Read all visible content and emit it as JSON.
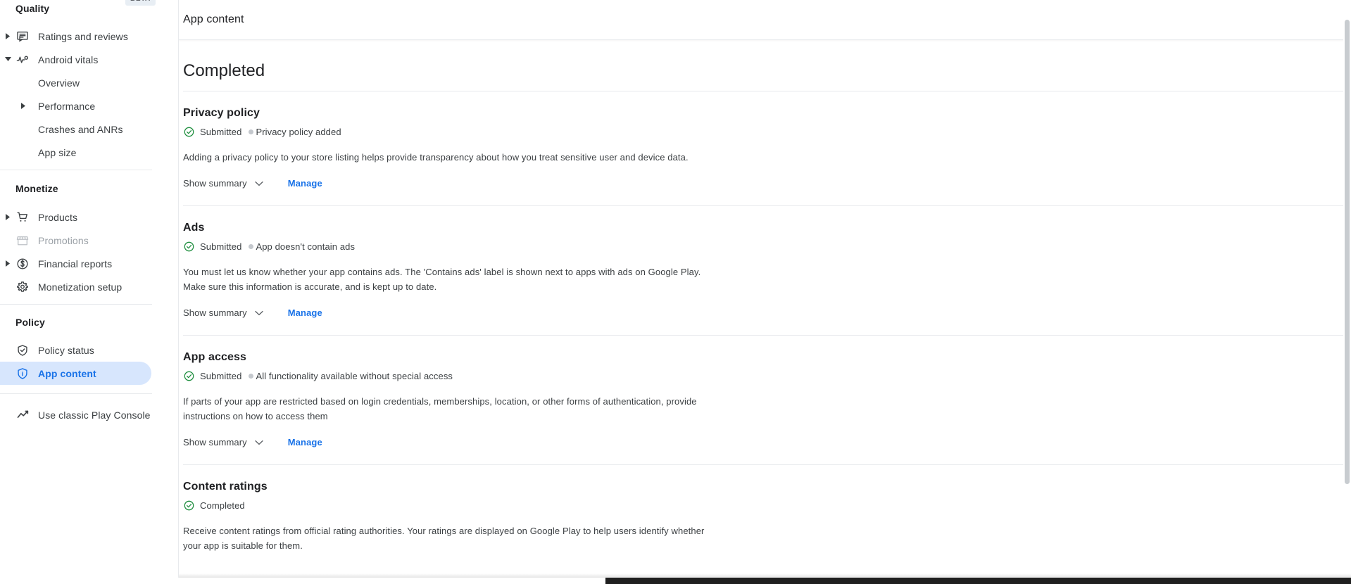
{
  "sidebar": {
    "beta_badge": "BETA",
    "groups": [
      {
        "label": "Quality",
        "items": [
          {
            "label": "Ratings and reviews",
            "icon": "reviews-icon",
            "caret": "collapsed",
            "level": 0
          },
          {
            "label": "Android vitals",
            "icon": "vitals-icon",
            "caret": "expanded",
            "level": 0
          },
          {
            "label": "Overview",
            "icon": "",
            "caret": "none",
            "level": 1
          },
          {
            "label": "Performance",
            "icon": "",
            "caret": "collapsed",
            "level": 1
          },
          {
            "label": "Crashes and ANRs",
            "icon": "",
            "caret": "none",
            "level": 1
          },
          {
            "label": "App size",
            "icon": "",
            "caret": "none",
            "level": 1
          }
        ]
      },
      {
        "label": "Monetize",
        "items": [
          {
            "label": "Products",
            "icon": "cart-icon",
            "caret": "collapsed",
            "level": 0
          },
          {
            "label": "Promotions",
            "icon": "store-icon",
            "caret": "none",
            "level": 0,
            "disabled": true
          },
          {
            "label": "Financial reports",
            "icon": "dollar-circle-icon",
            "caret": "collapsed",
            "level": 0
          },
          {
            "label": "Monetization setup",
            "icon": "gear-icon",
            "caret": "none",
            "level": 0
          }
        ]
      },
      {
        "label": "Policy",
        "items": [
          {
            "label": "Policy status",
            "icon": "shield-check-icon",
            "caret": "none",
            "level": 0
          },
          {
            "label": "App content",
            "icon": "shield-info-icon",
            "caret": "none",
            "level": 0,
            "active": true
          }
        ]
      }
    ],
    "footer_item": {
      "label": "Use classic Play Console",
      "icon": "trend-line-icon"
    }
  },
  "topbar": {
    "title": "App content"
  },
  "main": {
    "page_heading": "Completed",
    "show_summary_label": "Show summary",
    "manage_label": "Manage",
    "sections": [
      {
        "title": "Privacy policy",
        "status": "Submitted",
        "detail": "Privacy policy added",
        "description": "Adding a privacy policy to your store listing helps provide transparency about how you treat sensitive user and device data."
      },
      {
        "title": "Ads",
        "status": "Submitted",
        "detail": "App doesn't contain ads",
        "description": "You must let us know whether your app contains ads. The 'Contains ads' label is shown next to apps with ads on Google Play. Make sure this information is accurate, and is kept up to date."
      },
      {
        "title": "App access",
        "status": "Submitted",
        "detail": "All functionality available without special access",
        "description": "If parts of your app are restricted based on login credentials, memberships, location, or other forms of authentication, provide instructions on how to access them"
      },
      {
        "title": "Content ratings",
        "status": "Completed",
        "detail": "",
        "description": "Receive content ratings from official rating authorities. Your ratings are displayed on Google Play to help users identify whether your app is suitable for them."
      }
    ]
  },
  "colors": {
    "accent": "#1a73e8",
    "success": "#1e8e3e",
    "active_pill": "#d7e6fd",
    "text": "#202124",
    "muted": "#5f6368"
  }
}
